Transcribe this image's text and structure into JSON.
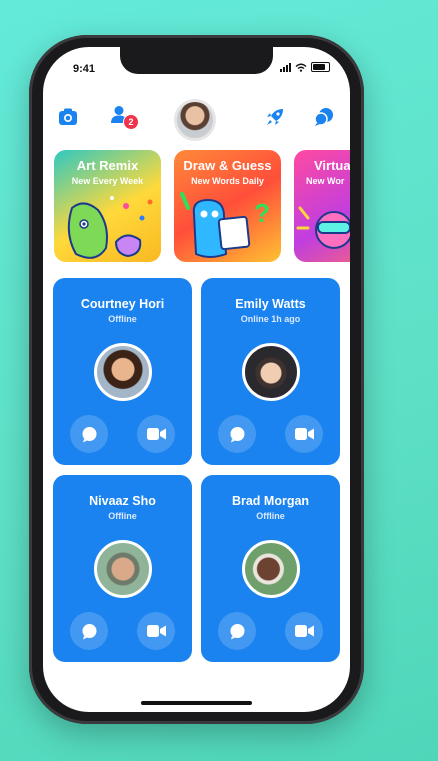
{
  "status_bar": {
    "time": "9:41"
  },
  "top_bar": {
    "friend_requests_badge": "2",
    "icons": [
      "camera-icon",
      "friends-icon",
      "profile-avatar",
      "rocket-icon",
      "chats-icon"
    ]
  },
  "apps": [
    {
      "title": "Art Remix",
      "subtitle": "New Every Week",
      "color": "#ffcf2e"
    },
    {
      "title": "Draw & Guess",
      "subtitle": "New Words Daily",
      "color": "#ff5a3c"
    },
    {
      "title": "Virtua",
      "subtitle": "New Wor",
      "color": "#ff3fa6"
    }
  ],
  "contacts": [
    {
      "name": "Courtney Hori",
      "status": "Offline"
    },
    {
      "name": "Emily Watts",
      "status": "Online 1h ago"
    },
    {
      "name": "Nivaaz Sho",
      "status": "Offline"
    },
    {
      "name": "Brad Morgan",
      "status": "Offline"
    }
  ],
  "colors": {
    "accent": "#1a83f0",
    "background": "#5ee0c6",
    "badge": "#f0324b"
  }
}
